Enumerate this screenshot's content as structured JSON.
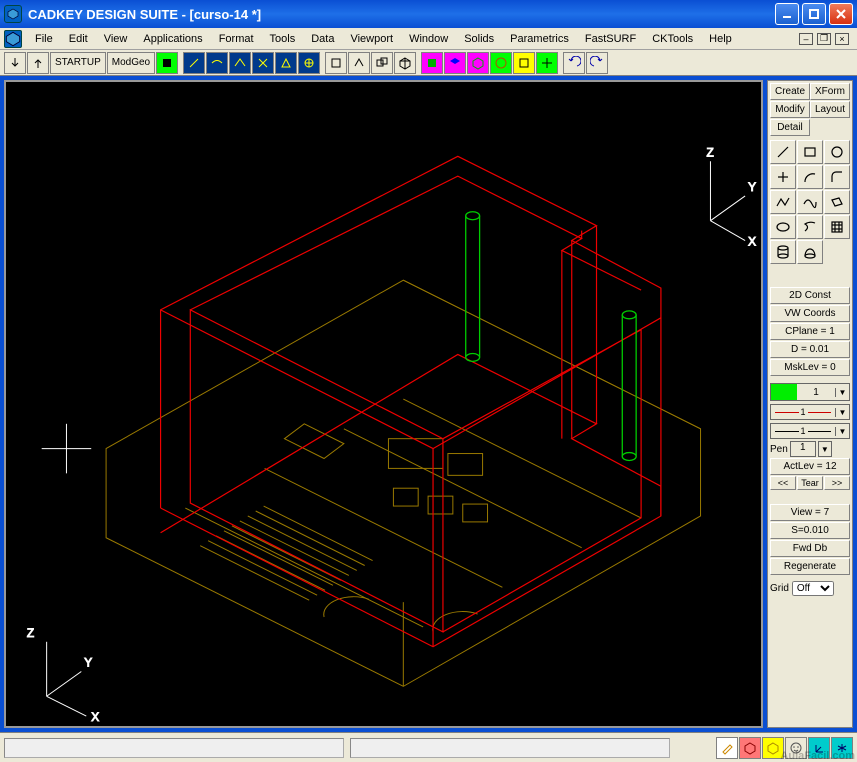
{
  "title": "CADKEY DESIGN SUITE - [curso-14 *]",
  "menus": [
    "File",
    "Edit",
    "View",
    "Applications",
    "Format",
    "Tools",
    "Data",
    "Viewport",
    "Window",
    "Solids",
    "Parametrics",
    "FastSURF",
    "CKTools",
    "Help"
  ],
  "toolbar": {
    "startup": "STARTUP",
    "modgeo": "ModGeo"
  },
  "side": {
    "tabs1": [
      "Create",
      "XForm"
    ],
    "tabs2": [
      "Modify",
      "Layout"
    ],
    "tabs3": [
      "Detail"
    ],
    "btn_2dconst": "2D Const",
    "btn_vwcoords": "VW Coords",
    "cplane": "CPlane = 1",
    "d": "D = 0.01",
    "msklev": "MskLev =  0",
    "color_val": "1",
    "line1_val": "1",
    "line2_val": "1",
    "pen_label": "Pen",
    "pen_val": "1",
    "actlev": "ActLev = 12",
    "tear": [
      "<<",
      "Tear",
      ">>"
    ],
    "view": "View =  7",
    "s": "S=0.010",
    "fwddb": "Fwd Db",
    "regen": "Regenerate",
    "grid_label": "Grid",
    "grid_val": "Off"
  },
  "axes": {
    "x": "X",
    "y": "Y",
    "z": "Z"
  },
  "watermark": "AulaFacil.com"
}
